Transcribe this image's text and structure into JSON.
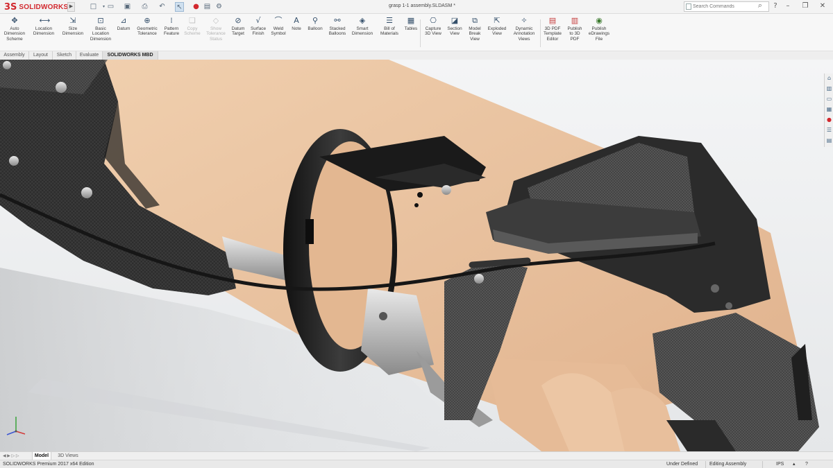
{
  "app": {
    "logo_mark": "3S",
    "logo_text": "SOLIDWORKS",
    "document_title": "grasp 1-1 assembly.SLDASM *",
    "search_placeholder": "Search Commands"
  },
  "quick_access_icons": [
    "new-document-icon",
    "open-icon",
    "save-icon",
    "print-icon",
    "undo-icon",
    "select-icon",
    "rebuild-icon",
    "file-properties-icon",
    "options-icon"
  ],
  "toolbar": {
    "tools": [
      {
        "label": "Auto\nDimension\nScheme",
        "icon": "auto-dimension-icon",
        "enabled": true
      },
      {
        "label": "Location\nDimension",
        "icon": "location-dimension-icon",
        "enabled": true
      },
      {
        "label": "Size\nDimension",
        "icon": "size-dimension-icon",
        "enabled": true
      },
      {
        "label": "Basic\nLocation\nDimension",
        "icon": "basic-location-dimension-icon",
        "enabled": true
      },
      {
        "label": "Datum",
        "icon": "datum-icon",
        "enabled": true
      },
      {
        "label": "Geometric\nTolerance",
        "icon": "geometric-tolerance-icon",
        "enabled": true
      },
      {
        "label": "Pattern\nFeature",
        "icon": "pattern-feature-icon",
        "enabled": true
      },
      {
        "label": "Copy\nScheme",
        "icon": "copy-scheme-icon",
        "enabled": false
      },
      {
        "label": "Show\nTolerance\nStatus",
        "icon": "show-tolerance-status-icon",
        "enabled": false
      },
      {
        "label": "Datum\nTarget",
        "icon": "datum-target-icon",
        "enabled": true
      },
      {
        "label": "Surface\nFinish",
        "icon": "surface-finish-icon",
        "enabled": true
      },
      {
        "label": "Weld\nSymbol",
        "icon": "weld-symbol-icon",
        "enabled": true
      },
      {
        "label": "Note",
        "icon": "note-icon",
        "enabled": true
      },
      {
        "label": "Balloon",
        "icon": "balloon-icon",
        "enabled": true
      },
      {
        "label": "Stacked\nBalloons",
        "icon": "stacked-balloons-icon",
        "enabled": true
      },
      {
        "label": "Smart\nDimension",
        "icon": "smart-dimension-icon",
        "enabled": true
      },
      {
        "label": "Bill of\nMaterials",
        "icon": "bill-of-materials-icon",
        "enabled": true
      },
      {
        "label": "Tables",
        "icon": "tables-icon",
        "enabled": true
      },
      {
        "label": "Capture\n3D View",
        "icon": "capture-3d-view-icon",
        "enabled": true
      },
      {
        "label": "Section\nView",
        "icon": "section-view-icon",
        "enabled": true
      },
      {
        "label": "Model\nBreak\nView",
        "icon": "model-break-view-icon",
        "enabled": true
      },
      {
        "label": "Exploded\nView",
        "icon": "exploded-view-icon",
        "enabled": true
      },
      {
        "label": "Dynamic\nAnnotation\nViews",
        "icon": "dynamic-annotation-views-icon",
        "enabled": true
      },
      {
        "label": "3D PDF\nTemplate\nEditor",
        "icon": "3d-pdf-template-editor-icon",
        "enabled": true
      },
      {
        "label": "Publish\nto 3D\nPDF",
        "icon": "publish-3d-pdf-icon",
        "enabled": true
      },
      {
        "label": "Publish\neDrawings\nFile",
        "icon": "publish-edrawings-icon",
        "enabled": true
      }
    ]
  },
  "tabs": [
    {
      "label": "Assembly",
      "active": false
    },
    {
      "label": "Layout",
      "active": false
    },
    {
      "label": "Sketch",
      "active": false
    },
    {
      "label": "Evaluate",
      "active": false
    },
    {
      "label": "SOLIDWORKS MBD",
      "active": true
    }
  ],
  "heads_up_toolbar_icons": [
    "zoom-to-fit-icon",
    "zoom-to-area-icon",
    "previous-view-icon",
    "section-view-icon",
    "dynamic-annotation-icon",
    "view-orientation-icon",
    "display-style-icon",
    "hide-show-items-icon",
    "edit-appearance-icon",
    "apply-scene-icon",
    "view-settings-icon",
    "display-pane-icon"
  ],
  "task_pane_icons": [
    "solidworks-resources-icon",
    "design-library-icon",
    "file-explorer-icon",
    "view-palette-icon",
    "appearances-icon",
    "custom-properties-icon",
    "forum-icon"
  ],
  "bottom_tabs": [
    {
      "label": "Model",
      "active": true
    },
    {
      "label": "3D Views",
      "active": false
    }
  ],
  "status_bar": {
    "edition": "SOLIDWORKS Premium 2017 x64 Edition",
    "definition": "Under Defined",
    "mode": "Editing Assembly",
    "units": "IPS"
  },
  "colors": {
    "brand": "#d2282e",
    "viewport_top": "#f4f5f6",
    "viewport_bottom": "#e5e7e9",
    "carbon_fiber": "#2b2b2b",
    "skin": "#e9c4a2"
  }
}
